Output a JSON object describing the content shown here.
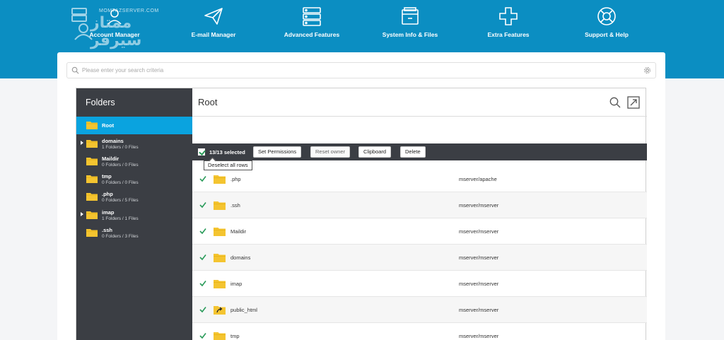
{
  "header": {
    "logo_text": "ممتاز سيرفر",
    "logo_site": "MOMTAZSERVER.COM",
    "nav": [
      {
        "label": "Account Manager",
        "icon": "account-manager-icon"
      },
      {
        "label": "E-mail Manager",
        "icon": "paper-plane-icon"
      },
      {
        "label": "Advanced Features",
        "icon": "server-icon"
      },
      {
        "label": "System Info & Files",
        "icon": "file-cabinet-icon"
      },
      {
        "label": "Extra Features",
        "icon": "plus-icon"
      },
      {
        "label": "Support & Help",
        "icon": "lifebuoy-icon"
      }
    ]
  },
  "search": {
    "placeholder": "Please enter your search criteria"
  },
  "sidebar": {
    "title": "Folders",
    "folders": [
      {
        "name": "Root",
        "meta": "",
        "active": true,
        "expandable": false
      },
      {
        "name": "domains",
        "meta": "1 Folders / 0 Files",
        "active": false,
        "expandable": true
      },
      {
        "name": "Maildir",
        "meta": "0 Folders / 0 Files",
        "active": false,
        "expandable": false
      },
      {
        "name": "tmp",
        "meta": "0 Folders / 0 Files",
        "active": false,
        "expandable": false
      },
      {
        "name": ".php",
        "meta": "0 Folders / 5 Files",
        "active": false,
        "expandable": false
      },
      {
        "name": "imap",
        "meta": "1 Folders / 1 Files",
        "active": false,
        "expandable": true
      },
      {
        "name": ".ssh",
        "meta": "0 Folders / 3 Files",
        "active": false,
        "expandable": false
      }
    ]
  },
  "main": {
    "title": "Root",
    "toolbar": {
      "selected": "13/13 selected",
      "set_permissions": "Set Permissions",
      "reset_owner": "Reset owner",
      "clipboard": "Clipboard",
      "delete": "Delete"
    },
    "tooltip": "Deselect all rows",
    "rows": [
      {
        "name": ".php",
        "owner": "mserver/apache",
        "type": "folder"
      },
      {
        "name": ".ssh",
        "owner": "mserver/mserver",
        "type": "folder"
      },
      {
        "name": "Maildir",
        "owner": "mserver/mserver",
        "type": "folder"
      },
      {
        "name": "domains",
        "owner": "mserver/mserver",
        "type": "folder"
      },
      {
        "name": "imap",
        "owner": "mserver/mserver",
        "type": "folder"
      },
      {
        "name": "public_html",
        "owner": "mserver/mserver",
        "type": "link"
      },
      {
        "name": "tmp",
        "owner": "mserver/mserver",
        "type": "folder"
      }
    ]
  },
  "colors": {
    "topbar": "#0b8ec2",
    "sidebar": "#3b3e44",
    "active_folder": "#0aa3df",
    "folder": "#f4c430",
    "check": "#2a9b5a"
  }
}
